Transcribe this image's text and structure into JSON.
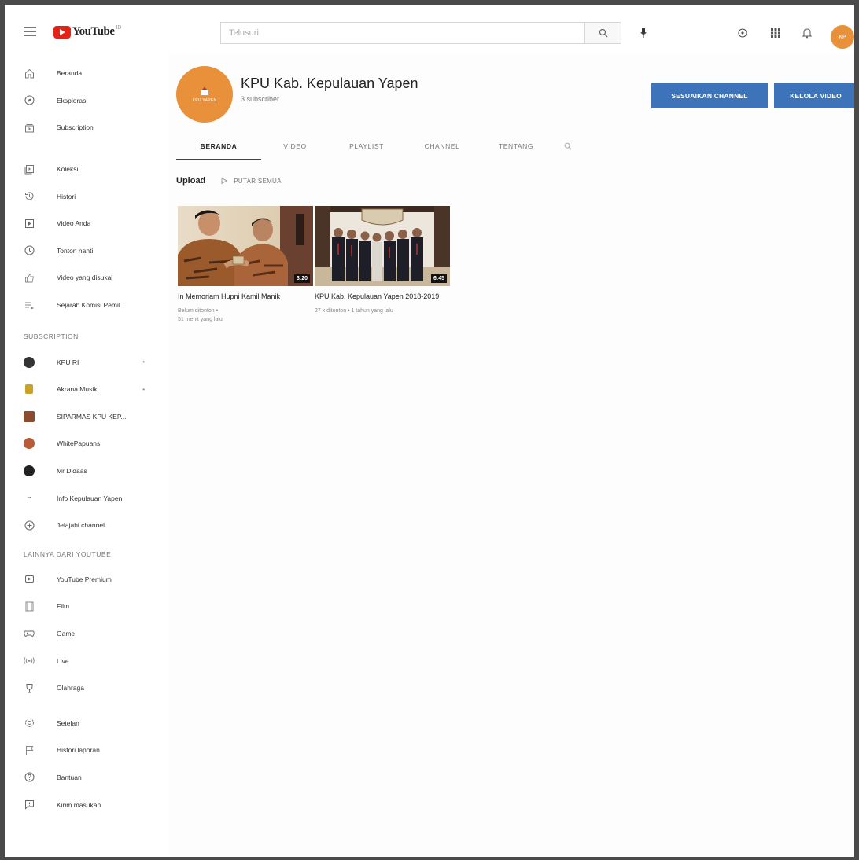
{
  "topbar": {
    "logo_text": "YouTube",
    "logo_sup": "ID",
    "search_placeholder": "Telusuri",
    "avatar_initials": "KP"
  },
  "sidebar": {
    "main_items": [
      {
        "label": "Beranda",
        "icon": "home-icon"
      },
      {
        "label": "Eksplorasi",
        "icon": "compass-icon"
      },
      {
        "label": "Subscription",
        "icon": "subscriptions-icon"
      }
    ],
    "library_items": [
      {
        "label": "Koleksi",
        "icon": "library-icon"
      },
      {
        "label": "Histori",
        "icon": "history-icon"
      },
      {
        "label": "Video Anda",
        "icon": "your-videos-icon"
      },
      {
        "label": "Tonton nanti",
        "icon": "clock-icon"
      },
      {
        "label": "Video yang disukai",
        "icon": "thumbs-up-icon"
      },
      {
        "label": "Sejarah Komisi Pemil...",
        "icon": "playlist-icon"
      }
    ],
    "subscription_heading": "SUBSCRIPTION",
    "subscriptions": [
      {
        "label": "KPU RI",
        "color": "#333333",
        "dot": true
      },
      {
        "label": "Akrana Musik",
        "color": "#c9a227",
        "dot": true
      },
      {
        "label": "SIPARMAS KPU KEP...",
        "color": "#8a4b2f",
        "dot": false
      },
      {
        "label": "WhitePapuans",
        "color": "#b85c38",
        "dot": false
      },
      {
        "label": "Mr Didaas",
        "color": "#222222",
        "dot": false
      },
      {
        "label": "Info Kepulauan Yapen",
        "color": "#888888",
        "dot": false
      },
      {
        "label": "Jelajahi channel",
        "color": "#666666",
        "dot": false
      }
    ],
    "more_heading": "LAINNYA DARI YOUTUBE",
    "more_items": [
      {
        "label": "YouTube Premium",
        "icon": "youtube-premium-icon"
      },
      {
        "label": "Film",
        "icon": "film-icon"
      },
      {
        "label": "Game",
        "icon": "gaming-icon"
      },
      {
        "label": "Live",
        "icon": "live-icon"
      },
      {
        "label": "Olahraga",
        "icon": "sports-icon"
      }
    ],
    "settings_items": [
      {
        "label": "Setelan",
        "icon": "gear-icon"
      },
      {
        "label": "Histori laporan",
        "icon": "flag-icon"
      },
      {
        "label": "Bantuan",
        "icon": "help-icon"
      },
      {
        "label": "Kirim masukan",
        "icon": "feedback-icon"
      }
    ]
  },
  "channel": {
    "name": "KPU Kab. Kepulauan Yapen",
    "subscribers": "3 subscriber",
    "avatar_text": "KPU YAPEN",
    "customize_label": "SESUAIKAN CHANNEL",
    "manage_label": "KELOLA VIDEO",
    "tabs": [
      "BERANDA",
      "VIDEO",
      "PLAYLIST",
      "CHANNEL",
      "TENTANG"
    ],
    "section_title": "Upload",
    "play_all_label": "PUTAR SEMUA"
  },
  "videos": [
    {
      "title": "In Memoriam Hupni Kamil Manik",
      "duration": "3:20",
      "meta_line1": "Belum ditonton •",
      "meta_line2": "51 menit yang lalu"
    },
    {
      "title": "KPU Kab. Kepulauan Yapen 2018-2019",
      "duration": "6:45",
      "meta_line1": "27 x ditonton • 1 tahun yang lalu",
      "meta_line2": ""
    }
  ],
  "colors": {
    "brand_red": "#e62117",
    "button_blue": "#3d73b9",
    "channel_orange": "#e8913a"
  }
}
